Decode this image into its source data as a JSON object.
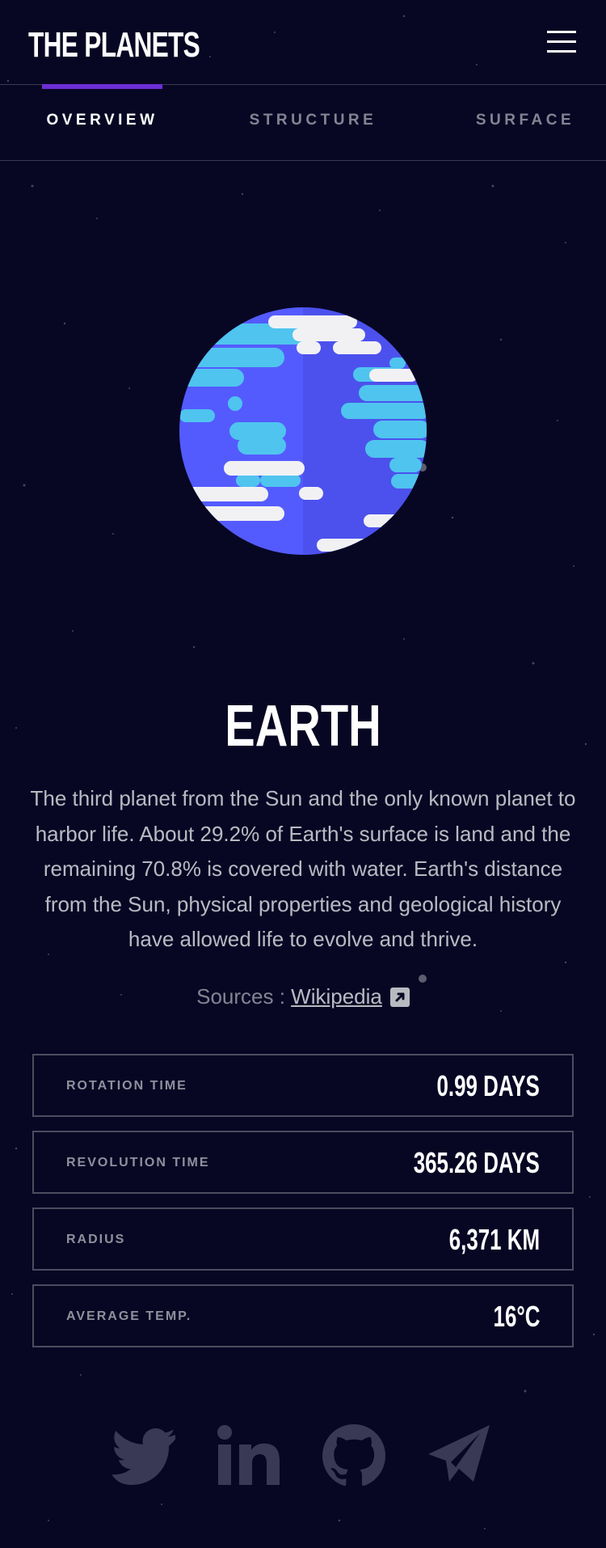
{
  "header": {
    "logo": "THE PLANETS",
    "menu_icon": "hamburger-menu-icon"
  },
  "tabs": [
    {
      "label": "OVERVIEW",
      "active": true
    },
    {
      "label": "STRUCTURE",
      "active": false
    },
    {
      "label": "SURFACE",
      "active": false
    }
  ],
  "colors": {
    "background": "#070724",
    "accent": "#6d2ed5",
    "planet_ocean": "#545bfe",
    "planet_cyan": "#4fc4ef",
    "planet_cloud": "#f1f1f4"
  },
  "planet": {
    "name": "EARTH",
    "description": "The third planet from the Sun and the only known planet to harbor life. About 29.2% of Earth's surface is land and the remaining 70.8% is covered with water. Earth's distance from the Sun, physical properties and geological history have allowed life to evolve and thrive.",
    "source_label": "Sources :",
    "source_link": "Wikipedia",
    "source_icon": "external-link-icon"
  },
  "stats": [
    {
      "label": "ROTATION TIME",
      "value": "0.99 DAYS"
    },
    {
      "label": "REVOLUTION TIME",
      "value": "365.26 DAYS"
    },
    {
      "label": "RADIUS",
      "value": "6,371 KM"
    },
    {
      "label": "AVERAGE TEMP.",
      "value": "16°C"
    }
  ],
  "footer": {
    "socials": [
      "twitter-icon",
      "linkedin-icon",
      "github-icon",
      "telegram-icon"
    ]
  }
}
